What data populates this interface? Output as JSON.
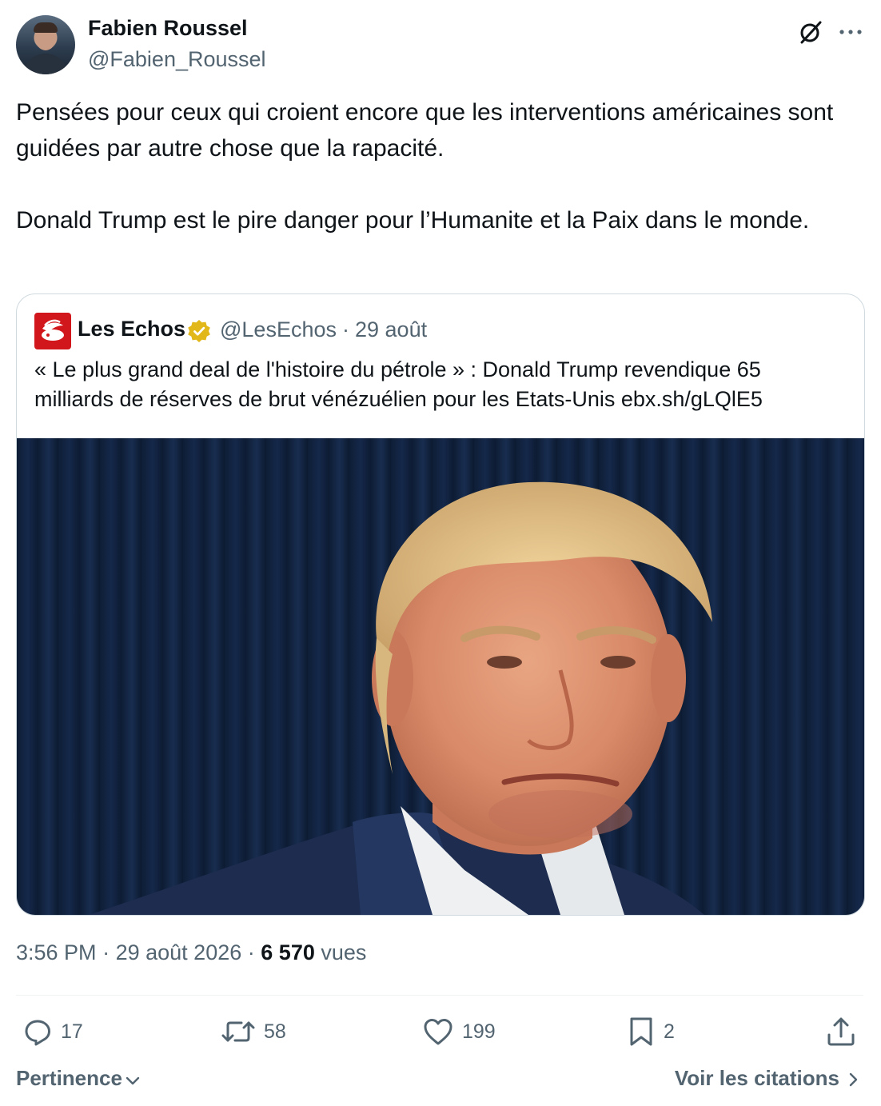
{
  "author": {
    "name": "Fabien Roussel",
    "handle": "@Fabien_Roussel"
  },
  "header_icons": {
    "grok": "grok-icon",
    "more": "more-icon"
  },
  "tweet": {
    "paragraphs": [
      "Pensées pour ceux qui croient encore que les interventions américaines sont guidées par autre chose que la rapacité.",
      "Donald Trump est le pire danger pour l’Humanite et la Paix dans le monde."
    ]
  },
  "quote": {
    "name": "Les Echos",
    "handle": "@LesEchos",
    "separator": "·",
    "date": "29 août",
    "text": "« Le plus grand deal de l'histoire du pétrole » : Donald Trump revendique 65 milliards de réserves de brut vénézuélien pour les Etats-Unis ebx.sh/gLQlE5",
    "verified_color": "#e2b719",
    "brand_color": "#d1171c",
    "image_icon": "portrait-photo"
  },
  "meta": {
    "time": "3:56 PM",
    "separator": "·",
    "date": "29 août 2026",
    "views_count": "6 570",
    "views_label": "vues"
  },
  "actions": {
    "replies": "17",
    "reposts": "58",
    "likes": "199",
    "bookmarks": "2"
  },
  "footer": {
    "sort_label": "Pertinence",
    "quotes_label": "Voir les citations"
  },
  "colors": {
    "text": "#0f1419",
    "secondary": "#536471",
    "border": "#cfd9de"
  }
}
